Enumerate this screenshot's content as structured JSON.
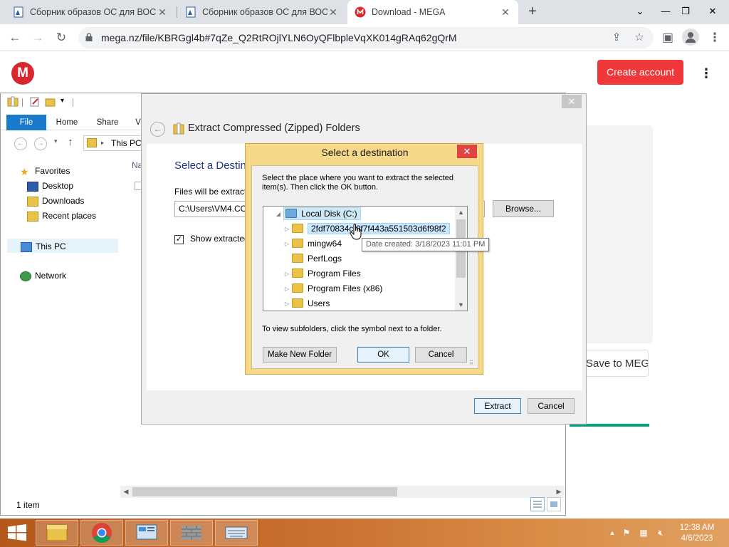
{
  "browser": {
    "tabs": [
      {
        "label": "Сборник образов ОС для ВОСН",
        "active": false
      },
      {
        "label": "Сборник образов ОС для ВОСН",
        "active": false
      },
      {
        "label": "Download - MEGA",
        "active": true
      }
    ],
    "url": "mega.nz/file/KBRGgl4b#7qZe_Q2RtROjlYLN6OyQFlbpleVqXK014gRAq62gQrM"
  },
  "mega": {
    "logo": "M",
    "create_account": "Create account",
    "save_to_mega": "Save to MEGA",
    "brand_color": "#d9272e",
    "button_color": "#f0373a"
  },
  "explorer": {
    "ribbon_tabs": [
      "File",
      "Home",
      "Share",
      "V"
    ],
    "address": "This PC",
    "content_header": "Na",
    "nav": {
      "favorites": "Favorites",
      "desktop": "Desktop",
      "downloads": "Downloads",
      "recent": "Recent places",
      "this_pc": "This PC",
      "network": "Network"
    },
    "status": "1 item"
  },
  "wizard": {
    "title": "Extract Compressed (Zipped) Folders",
    "heading": "Select a Destin",
    "files_extracted_to": "Files will be extracte",
    "path": "C:\\Users\\VM4.COI",
    "browse": "Browse...",
    "show_extracted": "Show extracted f",
    "show_extracted_checked": true,
    "extract": "Extract",
    "cancel": "Cancel"
  },
  "dialog": {
    "title": "Select a destination",
    "instructions": "Select the place where you want to extract the selected item(s).  Then click the OK button.",
    "tree": {
      "root": "Local Disk (C:)",
      "items": [
        {
          "label": "2fdf70834cf0f7f443a551503d6f98f2",
          "selected": true,
          "expandable": true
        },
        {
          "label": "mingw64",
          "selected": false,
          "expandable": true
        },
        {
          "label": "PerfLogs",
          "selected": false,
          "expandable": false
        },
        {
          "label": "Program Files",
          "selected": false,
          "expandable": true
        },
        {
          "label": "Program Files (x86)",
          "selected": false,
          "expandable": true
        },
        {
          "label": "Users",
          "selected": false,
          "expandable": true
        }
      ]
    },
    "tooltip": "Date created: 3/18/2023 11:01 PM",
    "hint": "To view subfolders, click the symbol next to a folder.",
    "make_new_folder": "Make New Folder",
    "ok": "OK",
    "cancel": "Cancel"
  },
  "taskbar": {
    "time": "12:38 AM",
    "date": "4/6/2023"
  }
}
